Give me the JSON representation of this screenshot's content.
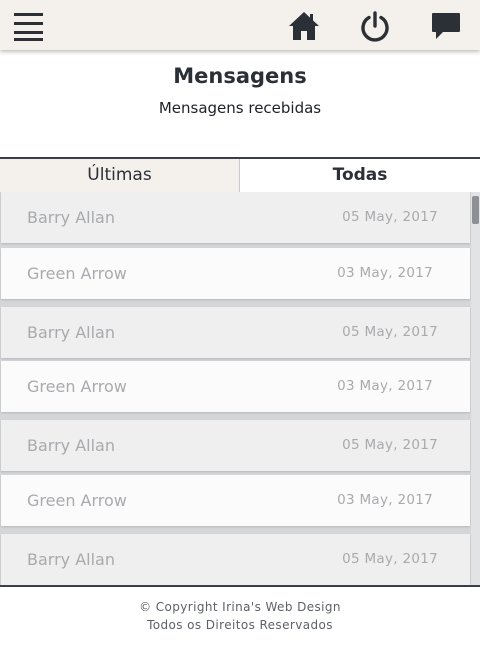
{
  "header": {
    "menu_icon": "hamburger-menu-icon",
    "icons": [
      "home-icon",
      "power-icon",
      "chat-bubble-icon"
    ],
    "background_color": "#f4f1ec",
    "icon_color": "#2b2f36"
  },
  "page": {
    "title": "Mensagens",
    "subtitle": "Mensagens recebidas"
  },
  "tabs": [
    {
      "label": "Últimas",
      "active": false
    },
    {
      "label": "Todas",
      "active": true
    }
  ],
  "messages": [
    {
      "sender": "Barry Allan",
      "date": "05 May, 2017"
    },
    {
      "sender": "Green Arrow",
      "date": "03 May, 2017"
    },
    {
      "sender": "Barry Allan",
      "date": "05 May, 2017"
    },
    {
      "sender": "Green Arrow",
      "date": "03 May, 2017"
    },
    {
      "sender": "Barry Allan",
      "date": "05 May, 2017"
    },
    {
      "sender": "Green Arrow",
      "date": "03 May, 2017"
    },
    {
      "sender": "Barry Allan",
      "date": "05 May, 2017"
    }
  ],
  "footer": {
    "copyright": "© Copyright Irina's Web Design",
    "rights": "Todos os Direitos Reservados"
  }
}
